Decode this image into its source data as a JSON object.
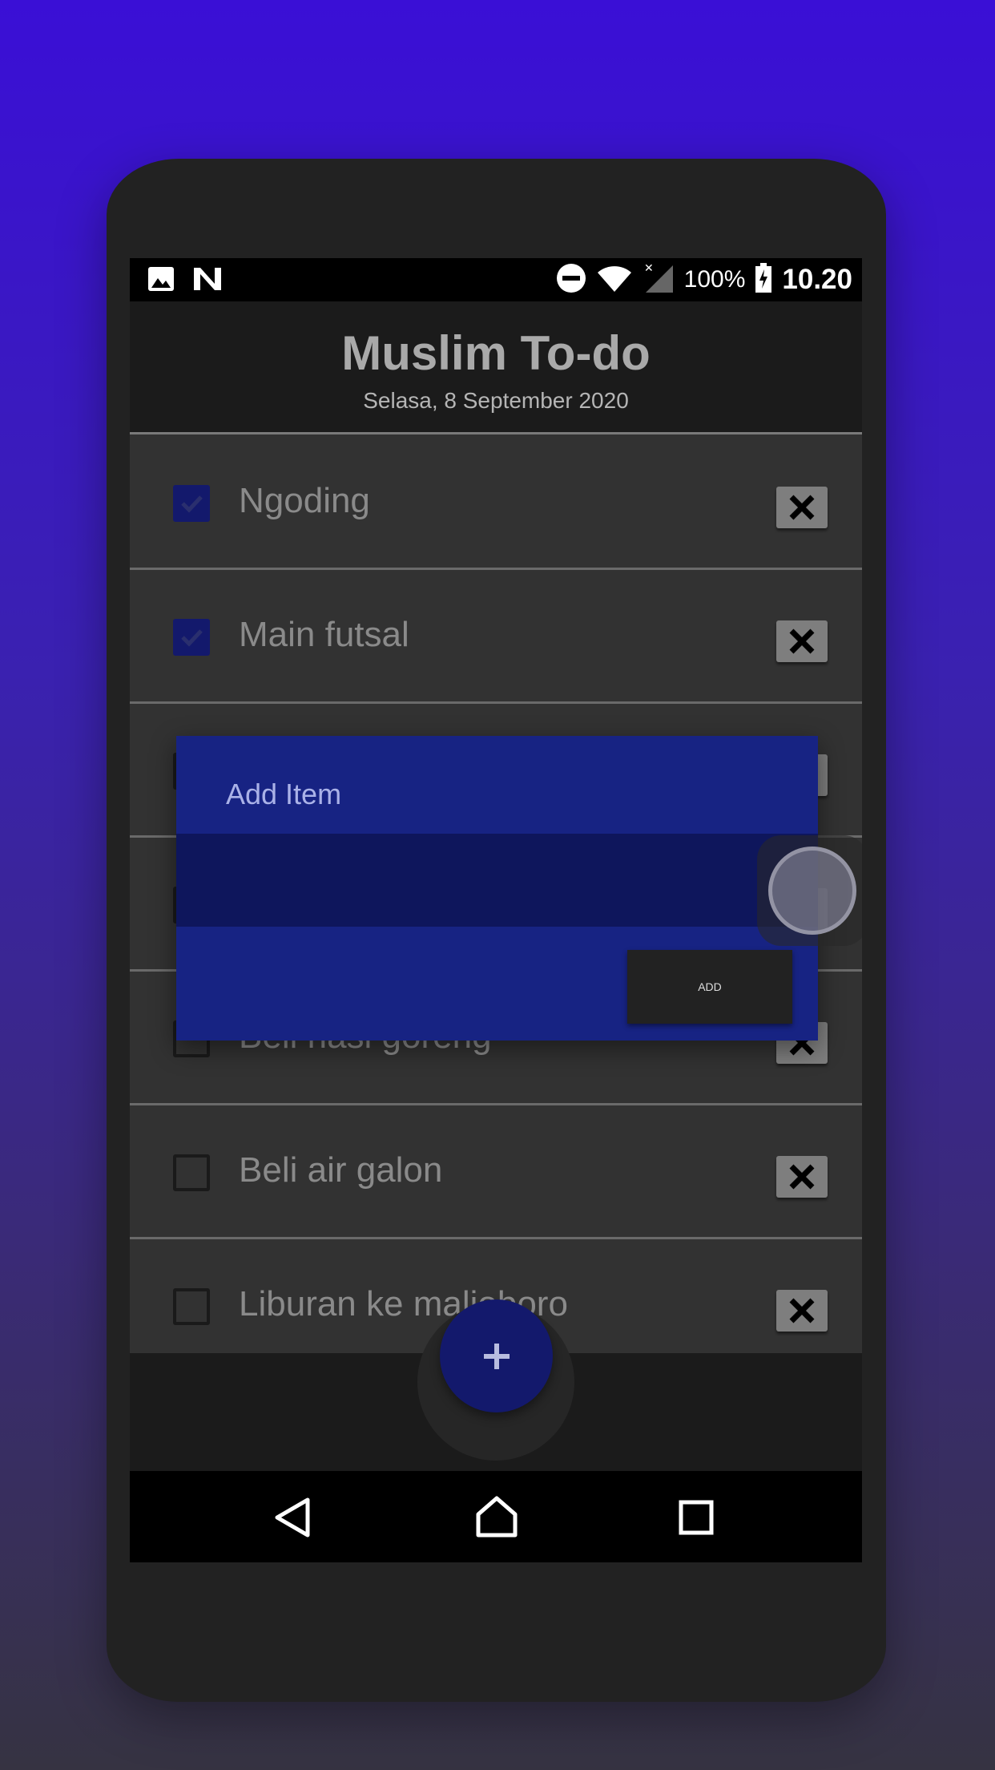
{
  "status_bar": {
    "battery_percent": "100%",
    "time": "10.20",
    "icons": [
      "image-icon",
      "n-icon",
      "do-not-disturb-icon",
      "wifi-icon",
      "signal-icon",
      "battery-charging-icon"
    ]
  },
  "header": {
    "title": "Muslim To-do",
    "date": "Selasa, 8 September 2020"
  },
  "todos": [
    {
      "label": "Ngoding",
      "checked": true
    },
    {
      "label": "Main futsal",
      "checked": true
    },
    {
      "label": "",
      "checked": false
    },
    {
      "label": "",
      "checked": false
    },
    {
      "label": "Beli nasi goreng",
      "checked": false
    },
    {
      "label": "Beli air galon",
      "checked": false
    },
    {
      "label": "Liburan ke malioboro",
      "checked": false
    }
  ],
  "dialog": {
    "title": "Add Item",
    "input_value": "",
    "add_label": "ADD"
  },
  "fab": {
    "icon": "plus-icon"
  },
  "nav_bar": {
    "icons": [
      "back-icon",
      "home-icon",
      "recent-apps-icon"
    ]
  },
  "colors": {
    "accent": "#13196c",
    "dialog": "#172383",
    "background_top": "#3a0fd6",
    "background_bottom": "#363342"
  }
}
